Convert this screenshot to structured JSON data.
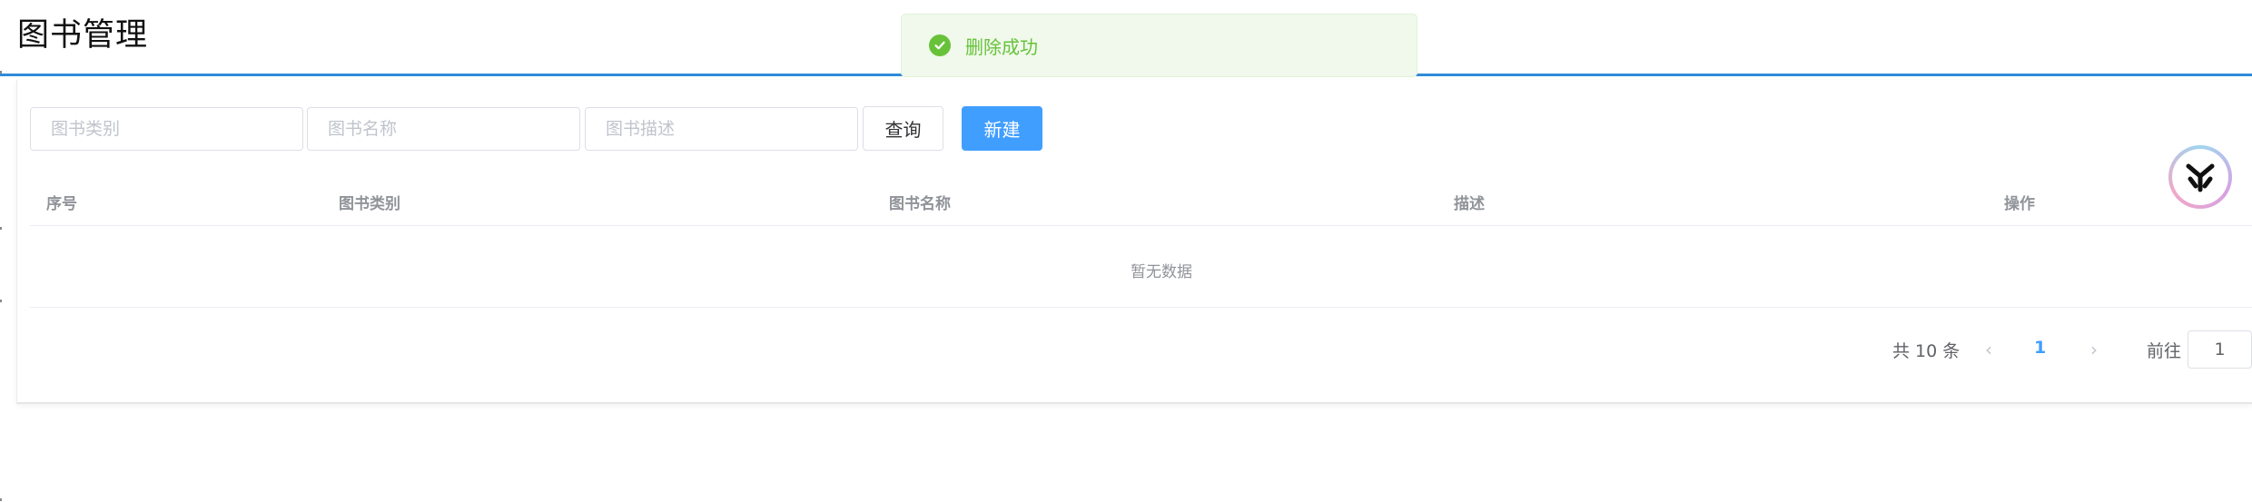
{
  "page": {
    "title": "图书管理"
  },
  "toast": {
    "message": "删除成功",
    "icon": "check-circle-icon",
    "color": "#67c23a"
  },
  "search": {
    "category_placeholder": "图书类别",
    "name_placeholder": "图书名称",
    "description_placeholder": "图书描述",
    "query_label": "查询",
    "create_label": "新建"
  },
  "table": {
    "columns": [
      "序号",
      "图书类别",
      "图书名称",
      "描述",
      "操作"
    ],
    "rows": [],
    "empty_text": "暂无数据"
  },
  "pagination": {
    "total_text": "共 10 条",
    "current_page": "1",
    "goto_label": "前往",
    "goto_value": "1"
  },
  "colors": {
    "accent": "#409eff",
    "title_rule": "#2f8bd8",
    "success": "#67c23a"
  },
  "float_logo": {
    "icon": "y-logo-icon"
  }
}
